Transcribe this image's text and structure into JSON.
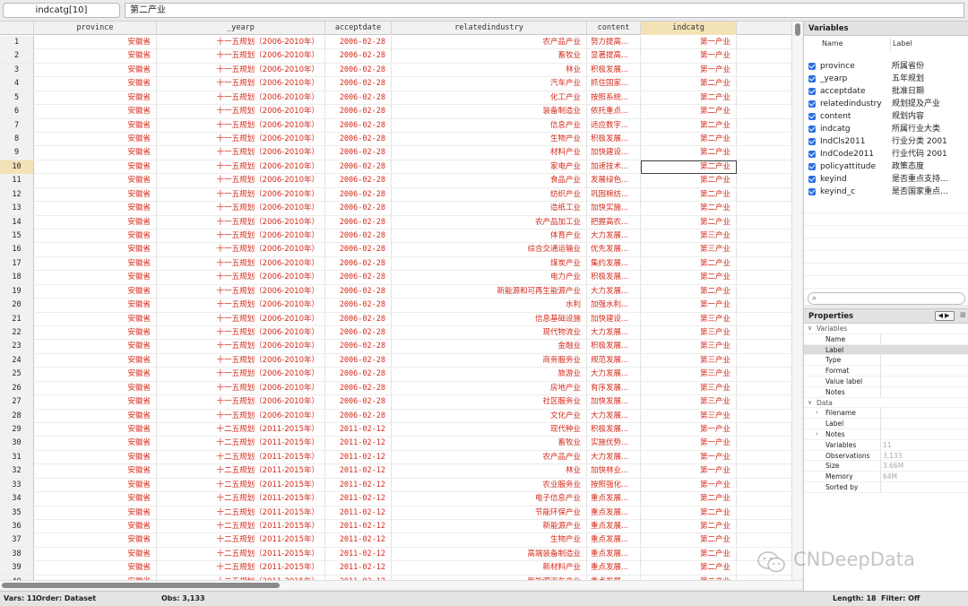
{
  "topbar": {
    "cell_ref": "indcatg[10]",
    "cell_value": "第二产业"
  },
  "columns": [
    "province",
    "_yearp",
    "acceptdate",
    "relatedindustry",
    "content",
    "indcatg"
  ],
  "rows": [
    {
      "n": "1",
      "province": "安徽省",
      "yearp": "十一五规划（2006-2010年）",
      "date": "2006-02-28",
      "industry": "农产品产业",
      "content": "努力提高...",
      "indcatg": "第一产业"
    },
    {
      "n": "2",
      "province": "安徽省",
      "yearp": "十一五规划（2006-2010年）",
      "date": "2006-02-28",
      "industry": "畜牧业",
      "content": "显著提高...",
      "indcatg": "第一产业"
    },
    {
      "n": "3",
      "province": "安徽省",
      "yearp": "十一五规划（2006-2010年）",
      "date": "2006-02-28",
      "industry": "林业",
      "content": "积极发展...",
      "indcatg": "第一产业"
    },
    {
      "n": "4",
      "province": "安徽省",
      "yearp": "十一五规划（2006-2010年）",
      "date": "2006-02-28",
      "industry": "汽车产业",
      "content": "抓住国家...",
      "indcatg": "第二产业"
    },
    {
      "n": "5",
      "province": "安徽省",
      "yearp": "十一五规划（2006-2010年）",
      "date": "2006-02-28",
      "industry": "化工产业",
      "content": "按照系统...",
      "indcatg": "第二产业"
    },
    {
      "n": "6",
      "province": "安徽省",
      "yearp": "十一五规划（2006-2010年）",
      "date": "2006-02-28",
      "industry": "装备制造业",
      "content": "依托重点...",
      "indcatg": "第二产业"
    },
    {
      "n": "7",
      "province": "安徽省",
      "yearp": "十一五规划（2006-2010年）",
      "date": "2006-02-28",
      "industry": "信息产业",
      "content": "适应数字...",
      "indcatg": "第二产业"
    },
    {
      "n": "8",
      "province": "安徽省",
      "yearp": "十一五规划（2006-2010年）",
      "date": "2006-02-28",
      "industry": "生物产业",
      "content": "积极发展...",
      "indcatg": "第二产业"
    },
    {
      "n": "9",
      "province": "安徽省",
      "yearp": "十一五规划（2006-2010年）",
      "date": "2006-02-28",
      "industry": "材料产业",
      "content": "加快建设...",
      "indcatg": "第二产业"
    },
    {
      "n": "10",
      "province": "安徽省",
      "yearp": "十一五规划（2006-2010年）",
      "date": "2006-02-28",
      "industry": "家电产业",
      "content": "加速技术...",
      "indcatg": "第二产业"
    },
    {
      "n": "11",
      "province": "安徽省",
      "yearp": "十一五规划（2006-2010年）",
      "date": "2006-02-28",
      "industry": "食品产业",
      "content": "发展绿色...",
      "indcatg": "第二产业"
    },
    {
      "n": "12",
      "province": "安徽省",
      "yearp": "十一五规划（2006-2010年）",
      "date": "2006-02-28",
      "industry": "纺织产业",
      "content": "巩固棉纺...",
      "indcatg": "第二产业"
    },
    {
      "n": "13",
      "province": "安徽省",
      "yearp": "十一五规划（2006-2010年）",
      "date": "2006-02-28",
      "industry": "造纸工业",
      "content": "加快实施...",
      "indcatg": "第二产业"
    },
    {
      "n": "14",
      "province": "安徽省",
      "yearp": "十一五规划（2006-2010年）",
      "date": "2006-02-28",
      "industry": "农产品加工业",
      "content": "把握高农...",
      "indcatg": "第二产业"
    },
    {
      "n": "15",
      "province": "安徽省",
      "yearp": "十一五规划（2006-2010年）",
      "date": "2006-02-28",
      "industry": "体育产业",
      "content": "大力发展...",
      "indcatg": "第三产业"
    },
    {
      "n": "16",
      "province": "安徽省",
      "yearp": "十一五规划（2006-2010年）",
      "date": "2006-02-28",
      "industry": "综合交通运输业",
      "content": "优先发展...",
      "indcatg": "第三产业"
    },
    {
      "n": "17",
      "province": "安徽省",
      "yearp": "十一五规划（2006-2010年）",
      "date": "2006-02-28",
      "industry": "煤炭产业",
      "content": "集约发展...",
      "indcatg": "第二产业"
    },
    {
      "n": "18",
      "province": "安徽省",
      "yearp": "十一五规划（2006-2010年）",
      "date": "2006-02-28",
      "industry": "电力产业",
      "content": "积极发展...",
      "indcatg": "第二产业"
    },
    {
      "n": "19",
      "province": "安徽省",
      "yearp": "十一五规划（2006-2010年）",
      "date": "2006-02-28",
      "industry": "新能源和可再生能源产业",
      "content": "大力发展...",
      "indcatg": "第二产业"
    },
    {
      "n": "20",
      "province": "安徽省",
      "yearp": "十一五规划（2006-2010年）",
      "date": "2006-02-28",
      "industry": "水利",
      "content": "加强水利...",
      "indcatg": "第一产业"
    },
    {
      "n": "21",
      "province": "安徽省",
      "yearp": "十一五规划（2006-2010年）",
      "date": "2006-02-28",
      "industry": "信息基础设施",
      "content": "加快建设...",
      "indcatg": "第三产业"
    },
    {
      "n": "22",
      "province": "安徽省",
      "yearp": "十一五规划（2006-2010年）",
      "date": "2006-02-28",
      "industry": "现代物流业",
      "content": "大力发展...",
      "indcatg": "第三产业"
    },
    {
      "n": "23",
      "province": "安徽省",
      "yearp": "十一五规划（2006-2010年）",
      "date": "2006-02-28",
      "industry": "金融业",
      "content": "积极发展...",
      "indcatg": "第三产业"
    },
    {
      "n": "24",
      "province": "安徽省",
      "yearp": "十一五规划（2006-2010年）",
      "date": "2006-02-28",
      "industry": "商务服务业",
      "content": "规范发展...",
      "indcatg": "第三产业"
    },
    {
      "n": "25",
      "province": "安徽省",
      "yearp": "十一五规划（2006-2010年）",
      "date": "2006-02-28",
      "industry": "旅游业",
      "content": "大力发展...",
      "indcatg": "第三产业"
    },
    {
      "n": "26",
      "province": "安徽省",
      "yearp": "十一五规划（2006-2010年）",
      "date": "2006-02-28",
      "industry": "房地产业",
      "content": "有序发展...",
      "indcatg": "第三产业"
    },
    {
      "n": "27",
      "province": "安徽省",
      "yearp": "十一五规划（2006-2010年）",
      "date": "2006-02-28",
      "industry": "社区服务业",
      "content": "加快发展...",
      "indcatg": "第三产业"
    },
    {
      "n": "28",
      "province": "安徽省",
      "yearp": "十一五规划（2006-2010年）",
      "date": "2006-02-28",
      "industry": "文化产业",
      "content": "大力发展...",
      "indcatg": "第三产业"
    },
    {
      "n": "29",
      "province": "安徽省",
      "yearp": "十二五规划（2011-2015年）",
      "date": "2011-02-12",
      "industry": "现代种业",
      "content": "积极发展...",
      "indcatg": "第一产业"
    },
    {
      "n": "30",
      "province": "安徽省",
      "yearp": "十二五规划（2011-2015年）",
      "date": "2011-02-12",
      "industry": "畜牧业",
      "content": "实施优势...",
      "indcatg": "第一产业"
    },
    {
      "n": "31",
      "province": "安徽省",
      "yearp": "十二五规划（2011-2015年）",
      "date": "2011-02-12",
      "industry": "农产品产业",
      "content": "大力发展...",
      "indcatg": "第一产业"
    },
    {
      "n": "32",
      "province": "安徽省",
      "yearp": "十二五规划（2011-2015年）",
      "date": "2011-02-12",
      "industry": "林业",
      "content": "加快林业...",
      "indcatg": "第一产业"
    },
    {
      "n": "33",
      "province": "安徽省",
      "yearp": "十二五规划（2011-2015年）",
      "date": "2011-02-12",
      "industry": "农业服务业",
      "content": "按照强化...",
      "indcatg": "第一产业"
    },
    {
      "n": "34",
      "province": "安徽省",
      "yearp": "十二五规划（2011-2015年）",
      "date": "2011-02-12",
      "industry": "电子信息产业",
      "content": "重点发展...",
      "indcatg": "第二产业"
    },
    {
      "n": "35",
      "province": "安徽省",
      "yearp": "十二五规划（2011-2015年）",
      "date": "2011-02-12",
      "industry": "节能环保产业",
      "content": "重点发展...",
      "indcatg": "第二产业"
    },
    {
      "n": "36",
      "province": "安徽省",
      "yearp": "十二五规划（2011-2015年）",
      "date": "2011-02-12",
      "industry": "新能源产业",
      "content": "重点发展...",
      "indcatg": "第二产业"
    },
    {
      "n": "37",
      "province": "安徽省",
      "yearp": "十二五规划（2011-2015年）",
      "date": "2011-02-12",
      "industry": "生物产业",
      "content": "重点发展...",
      "indcatg": "第二产业"
    },
    {
      "n": "38",
      "province": "安徽省",
      "yearp": "十二五规划（2011-2015年）",
      "date": "2011-02-12",
      "industry": "高端装备制造业",
      "content": "重点发展...",
      "indcatg": "第二产业"
    },
    {
      "n": "39",
      "province": "安徽省",
      "yearp": "十二五规划（2011-2015年）",
      "date": "2011-02-12",
      "industry": "新材料产业",
      "content": "重点发展...",
      "indcatg": "第二产业"
    },
    {
      "n": "40",
      "province": "安徽省",
      "yearp": "十二五规划（2011-2015年）",
      "date": "2011-02-12",
      "industry": "新能源汽车产业",
      "content": "重点发展...",
      "indcatg": "第二产业"
    }
  ],
  "selected_row": "10",
  "variables_panel": {
    "title": "Variables",
    "col_name": "Name",
    "col_label": "Label",
    "items": [
      {
        "name": "province",
        "label": "所属省份"
      },
      {
        "name": "_yearp",
        "label": "五年规划"
      },
      {
        "name": "acceptdate",
        "label": "批准日期"
      },
      {
        "name": "relatedindustry",
        "label": "规划提及产业"
      },
      {
        "name": "content",
        "label": "规划内容"
      },
      {
        "name": "indcatg",
        "label": "所属行业大类"
      },
      {
        "name": "IndCls2011",
        "label": "行业分类 2001"
      },
      {
        "name": "IndCode2011",
        "label": "行业代码 2001"
      },
      {
        "name": "policyattitude",
        "label": "政策态度"
      },
      {
        "name": "keyind",
        "label": "是否重点支持..."
      },
      {
        "name": "keyind_c",
        "label": "是否国家重点..."
      }
    ]
  },
  "properties_panel": {
    "title": "Properties",
    "variables_section": "Variables",
    "var_props": [
      "Name",
      "Label",
      "Type",
      "Format",
      "Value label",
      "Notes"
    ],
    "data_section": "Data",
    "data_props": [
      {
        "key": "Filename",
        "val": "",
        "tw": "›"
      },
      {
        "key": "Label",
        "val": "",
        "tw": ""
      },
      {
        "key": "Notes",
        "val": "",
        "tw": "›"
      },
      {
        "key": "Variables",
        "val": "11",
        "tw": ""
      },
      {
        "key": "Observations",
        "val": "3,133",
        "tw": ""
      },
      {
        "key": "Size",
        "val": "3.66M",
        "tw": ""
      },
      {
        "key": "Memory",
        "val": "64M",
        "tw": ""
      },
      {
        "key": "Sorted by",
        "val": "",
        "tw": ""
      }
    ]
  },
  "status": {
    "vars": "Vars: 11",
    "order": "Order: Dataset",
    "obs": "Obs: 3,133",
    "length": "Length: 18",
    "filter": "Filter: Off"
  },
  "watermark": "CNDeepData",
  "colors": {
    "data_text": "#d42a1a",
    "highlight": "#f3e2b5",
    "checkbox": "#2a6fe0"
  }
}
